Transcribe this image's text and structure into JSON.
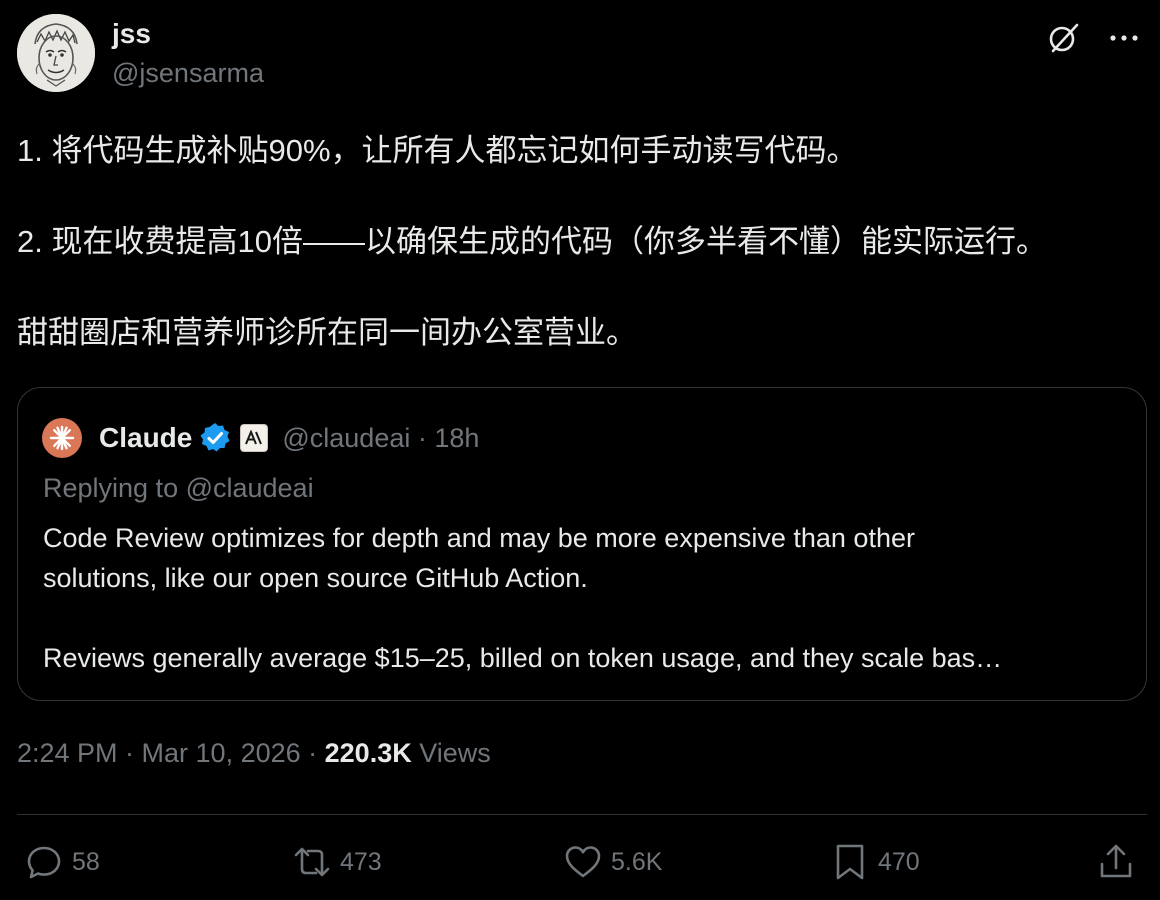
{
  "author": {
    "display_name": "jss",
    "handle": "@jsensarma"
  },
  "header_icons": [
    "grok-icon",
    "more-icon"
  ],
  "tweet": {
    "paragraphs": [
      "1. 将代码生成补贴90%，让所有人都忘记如何手动读写代码。",
      "2. 现在收费提高10倍——以确保生成的代码（你多半看不懂）能实际运行。",
      "甜甜圈店和营养师诊所在同一间办公室营业。"
    ]
  },
  "quote": {
    "display_name": "Claude",
    "meta": "@claudeai · 18h",
    "replying_to": "Replying to @claudeai",
    "lines": [
      "Code Review optimizes for depth and may be more expensive than other",
      "solutions, like our open source GitHub Action.",
      "Reviews generally average $15–25, billed on token usage, and they scale bas…"
    ]
  },
  "timestamp": {
    "text": "2:24 PM · Mar 10, 2026 · ",
    "views_count": "220.3K",
    "views_label": " Views"
  },
  "actions": {
    "replies": "58",
    "reposts": "473",
    "likes": "5.6K",
    "bookmarks": "470"
  },
  "colors": {
    "background": "#000000",
    "text": "#e7e9ea",
    "muted": "#71767b",
    "border": "#333639",
    "verified": "#1d9bf0",
    "claude_brand": "#d97757"
  }
}
